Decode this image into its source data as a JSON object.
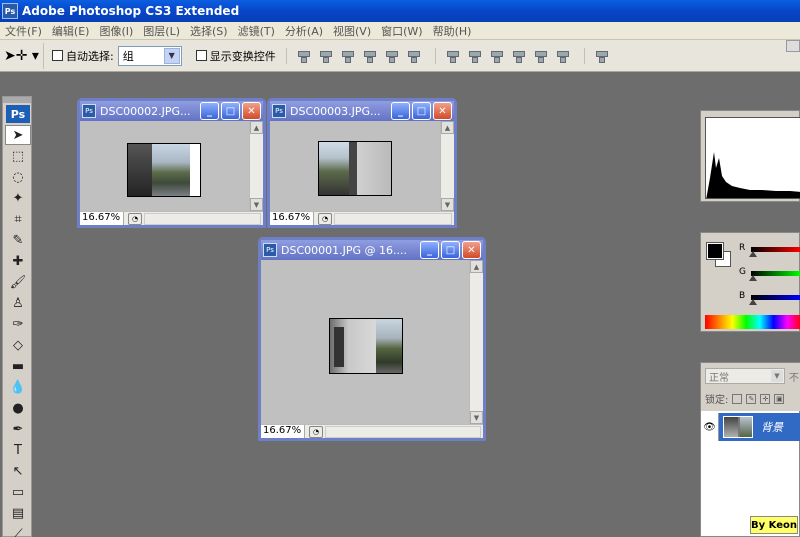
{
  "app": {
    "title": "Adobe Photoshop CS3 Extended",
    "badge": "Ps"
  },
  "menu": [
    "文件(F)",
    "编辑(E)",
    "图像(I)",
    "图层(L)",
    "选择(S)",
    "滤镜(T)",
    "分析(A)",
    "视图(V)",
    "窗口(W)",
    "帮助(H)"
  ],
  "options": {
    "tool_icon": "move-tool",
    "auto_select_label": "自动选择:",
    "auto_select_value": "组",
    "show_transform_label": "显示变换控件"
  },
  "toolbox": {
    "logo": "Ps"
  },
  "documents": [
    {
      "title": "DSC00002.JPG...",
      "zoom": "16.67%"
    },
    {
      "title": "DSC00003.JPG...",
      "zoom": "16.67%"
    },
    {
      "title": "DSC00001.JPG @ 16....",
      "zoom": "16.67%"
    }
  ],
  "color_panel": {
    "r_label": "R",
    "g_label": "G",
    "b_label": "B",
    "fg_color": "#000000",
    "bg_color": "#ffffff"
  },
  "layers_panel": {
    "blend_mode": "正常",
    "opacity_fragment": "不",
    "lock_label": "锁定:",
    "layer_name": "背景"
  },
  "credit": "By Keon"
}
